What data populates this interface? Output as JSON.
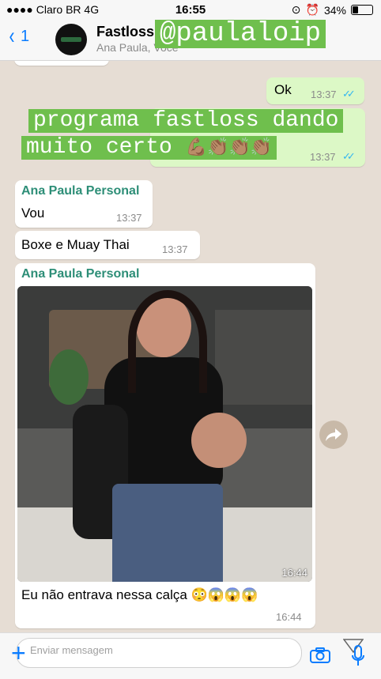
{
  "status_bar": {
    "carrier": "Claro BR",
    "network": "4G",
    "time": "16:55",
    "battery": "34%",
    "battery_level": 0.34
  },
  "header": {
    "back_count": "1",
    "title": "Fastloss",
    "subtitle": "Ana Paula, Você"
  },
  "overlay": {
    "handle": "@paulaloip",
    "line1": "programa fastloss dando",
    "line2": "muito certo",
    "emoji": "💪🏽👏🏽👏🏽👏🏽"
  },
  "messages": [
    {
      "text": "Ok",
      "time": "13:37",
      "ticks": "✓✓"
    },
    {
      "time": "13:37",
      "ticks": "✓✓"
    },
    {
      "sender": "Ana Paula Personal",
      "text": "Vou",
      "time": "13:37"
    },
    {
      "text": "Boxe e Muay Thai",
      "time": "13:37"
    },
    {
      "sender": "Ana Paula Personal",
      "time": "16:44"
    },
    {
      "text": "Eu não entrava nessa calça 😳😱😱😱",
      "time": "16:44"
    }
  ],
  "input": {
    "placeholder": "Enviar mensagem"
  },
  "colors": {
    "accent": "#0a7cff",
    "sender": "#2d8e77",
    "outgoing": "#dcf8c6",
    "highlight": "#6fbf4d",
    "read_ticks": "#34b7f1"
  },
  "icons": {
    "back": "chevron-left-icon",
    "camera": "camera-icon",
    "mic": "microphone-icon",
    "forward": "forward-icon",
    "plus": "plus-icon"
  }
}
